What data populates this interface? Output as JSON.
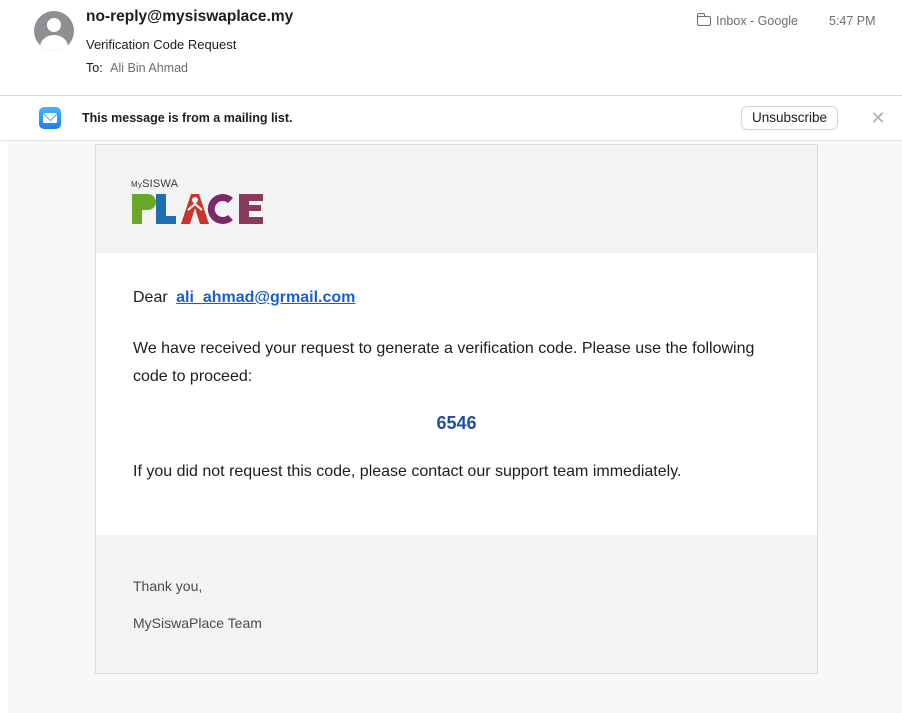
{
  "header": {
    "sender": "no-reply@mysiswaplace.my",
    "subject": "Verification Code Request",
    "to_label": "To:",
    "to_name": "Ali Bin Ahmad",
    "mailbox": "Inbox - Google",
    "time": "5:47 PM"
  },
  "banner": {
    "text": "This message is from a mailing list.",
    "unsubscribe_label": "Unsubscribe",
    "close_glyph": "✕"
  },
  "logo": {
    "top_small": "My",
    "top_text": "SISWA",
    "word": "PLACE",
    "colors": [
      "#6aa829",
      "#1f6fb0",
      "#c8352c",
      "#7a2a6b",
      "#8a3a5c"
    ]
  },
  "email": {
    "greeting_prefix": "Dear",
    "recipient_email": "ali_ahmad@grmail.com",
    "paragraph": "We have received your request to generate a verification code. Please use the following code to proceed:",
    "code": "6546",
    "notice": "If you did not request this code, please contact our support team immediately.",
    "thanks": "Thank you,",
    "team": "MySiswaPlace Team"
  }
}
